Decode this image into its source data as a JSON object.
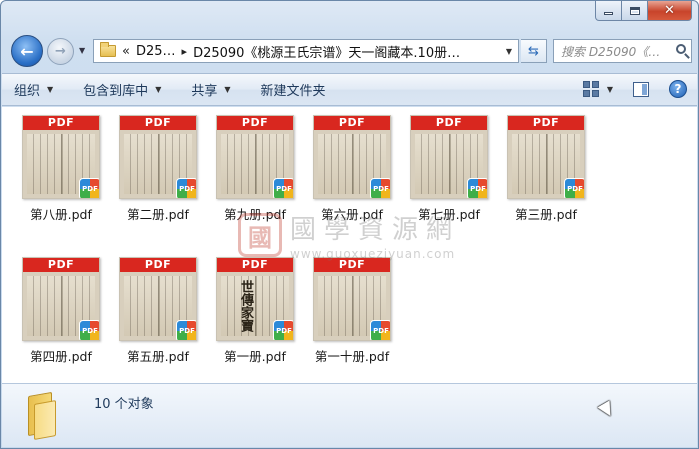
{
  "address": {
    "overflow": "«",
    "crumbs": [
      "D25…",
      "D25090《桃源王氏宗谱》天一阁藏本.10册…"
    ]
  },
  "search": {
    "placeholder": "搜索 D25090《…"
  },
  "toolbar": {
    "organize": "组织",
    "include_in_library": "包含到库中",
    "share": "共享",
    "new_folder": "新建文件夹"
  },
  "thumbnail_badge": "PDF",
  "files": [
    {
      "name": "第八册.pdf"
    },
    {
      "name": "第二册.pdf"
    },
    {
      "name": "第九册.pdf"
    },
    {
      "name": "第六册.pdf"
    },
    {
      "name": "第七册.pdf"
    },
    {
      "name": "第三册.pdf"
    },
    {
      "name": "第四册.pdf"
    },
    {
      "name": "第五册.pdf"
    },
    {
      "name": "第一册.pdf",
      "cover_title": "世傳家寶"
    },
    {
      "name": "第一十册.pdf"
    }
  ],
  "watermark": {
    "seal": "國",
    "text": "國學資源網",
    "url": "www.guoxueziyuan.com"
  },
  "status": {
    "item_count": "10 个对象"
  }
}
